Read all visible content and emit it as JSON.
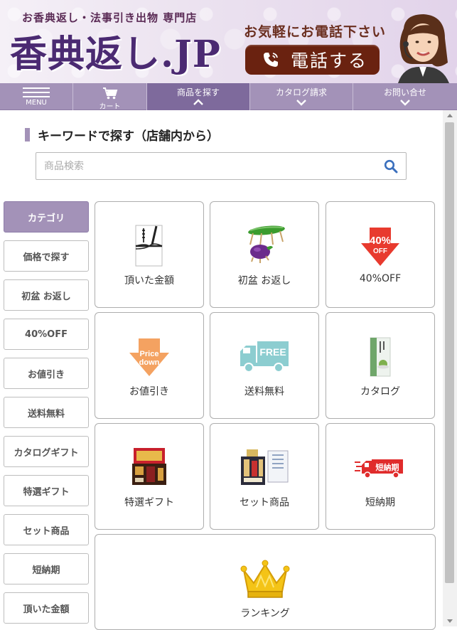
{
  "header": {
    "tagline": "お香典返し・法事引き出物 専門店",
    "logo": "香典返し.JP",
    "call_text": "お気軽にお電話下さい",
    "call_button": "電話する"
  },
  "nav": {
    "menu": "MENU",
    "cart": "カート",
    "search_products": "商品を探す",
    "catalog_request": "カタログ請求",
    "contact": "お問い合せ"
  },
  "search": {
    "title": "キーワードで探す（店舗内から）",
    "placeholder": "商品検索"
  },
  "sidebar": {
    "items": [
      {
        "label": "カテゴリ",
        "active": true
      },
      {
        "label": "価格で探す"
      },
      {
        "label": "初盆 お返し"
      },
      {
        "label": "40%OFF"
      },
      {
        "label": "お値引き"
      },
      {
        "label": "送料無料"
      },
      {
        "label": "カタログギフト"
      },
      {
        "label": "特選ギフト"
      },
      {
        "label": "セット商品"
      },
      {
        "label": "短納期"
      },
      {
        "label": "頂いた金額"
      }
    ]
  },
  "categories": [
    {
      "label": "頂いた金額",
      "icon": "noshi-envelope-icon"
    },
    {
      "label": "初盆 お返し",
      "icon": "cucumber-eggplant-icon"
    },
    {
      "label": "40%OFF",
      "icon": "discount-arrow-icon",
      "badge": "40%",
      "badge_sub": "OFF"
    },
    {
      "label": "お値引き",
      "icon": "price-down-arrow-icon",
      "badge": "Price",
      "badge_sub": "down"
    },
    {
      "label": "送料無料",
      "icon": "free-shipping-truck-icon",
      "badge": "FREE"
    },
    {
      "label": "カタログ",
      "icon": "catalog-book-icon"
    },
    {
      "label": "特選ギフト",
      "icon": "gift-box-icon"
    },
    {
      "label": "セット商品",
      "icon": "set-products-icon"
    },
    {
      "label": "短納期",
      "icon": "express-truck-icon",
      "badge": "短納期"
    },
    {
      "label": "ランキング",
      "icon": "crown-icon"
    }
  ],
  "colors": {
    "accent": "#a392b8",
    "accent_dark": "#7e6a9c",
    "call_button": "#6a2210",
    "discount_red": "#e83a2e",
    "price_down_orange": "#f4a261",
    "free_truck": "#8ccdd0"
  }
}
